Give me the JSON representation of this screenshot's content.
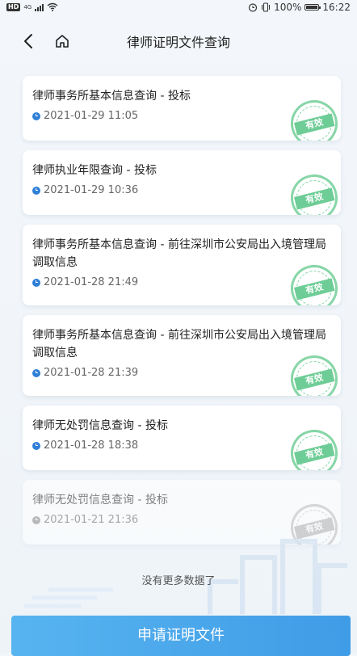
{
  "status_bar": {
    "hd": "HD",
    "network": "4G",
    "battery_pct": "100%",
    "time": "16:22"
  },
  "nav": {
    "back_icon": "chevron-left-icon",
    "home_icon": "home-icon",
    "title": "律师证明文件查询"
  },
  "records": [
    {
      "title": "律师事务所基本信息查询 - 投标",
      "date": "2021-01-29 11:05",
      "stamp": "有效"
    },
    {
      "title": "律师执业年限查询 - 投标",
      "date": "2021-01-29 10:36",
      "stamp": "有效"
    },
    {
      "title": "律师事务所基本信息查询 - 前往深圳市公安局出入境管理局调取信息",
      "date": "2021-01-28 21:49",
      "stamp": "有效"
    },
    {
      "title": "律师事务所基本信息查询 - 前往深圳市公安局出入境管理局调取信息",
      "date": "2021-01-28 21:39",
      "stamp": "有效"
    },
    {
      "title": "律师无处罚信息查询 - 投标",
      "date": "2021-01-28 18:38",
      "stamp": "有效"
    },
    {
      "title": "律师无处罚信息查询 - 投标",
      "date": "2021-01-21 21:36",
      "stamp": "有效"
    }
  ],
  "footer": {
    "no_more": "没有更多数据了",
    "apply_button": "申请证明文件"
  },
  "colors": {
    "accent": "#3f9ce6",
    "stamp_green": "#3ebd73",
    "clock_blue": "#2f7fd8"
  }
}
